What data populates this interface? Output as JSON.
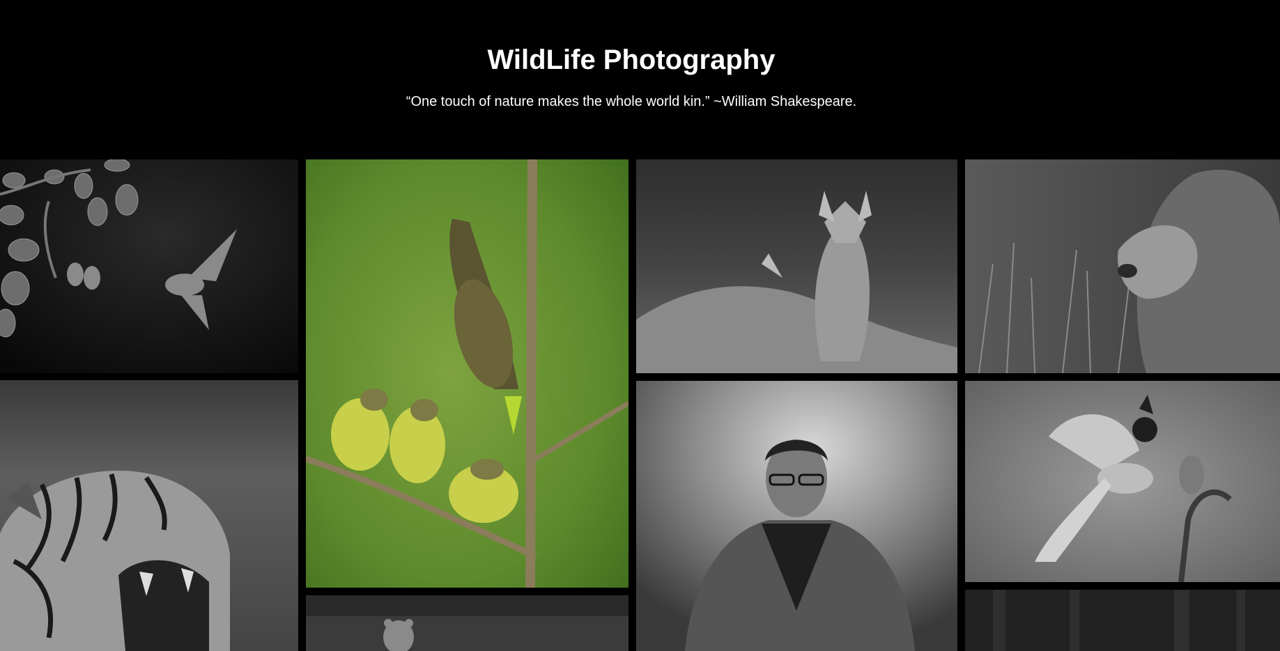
{
  "header": {
    "title": "WildLife Photography",
    "quote": "“One touch of nature makes the whole world kin.” ~William Shakespeare."
  },
  "colors": {
    "background": "#000000",
    "text": "#ffffff"
  },
  "gallery": {
    "photos": [
      {
        "subject": "sunbird feeding chicks",
        "tone": "grayscale"
      },
      {
        "subject": "tiger roaring",
        "tone": "grayscale"
      },
      {
        "subject": "bird feeding chicks on branch",
        "tone": "color"
      },
      {
        "subject": "bear",
        "tone": "grayscale"
      },
      {
        "subject": "fox",
        "tone": "grayscale"
      },
      {
        "subject": "photographer portrait",
        "tone": "grayscale"
      },
      {
        "subject": "lion",
        "tone": "grayscale"
      },
      {
        "subject": "paradise flycatcher feeding chick",
        "tone": "grayscale"
      },
      {
        "subject": "forest",
        "tone": "grayscale"
      }
    ]
  }
}
